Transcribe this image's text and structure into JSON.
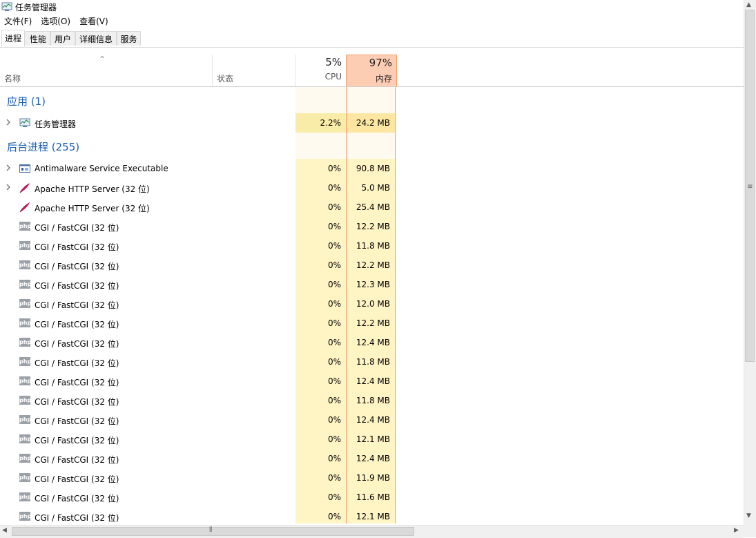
{
  "window": {
    "title": "任务管理器"
  },
  "menu": [
    "文件(F)",
    "选项(O)",
    "查看(V)"
  ],
  "tabs": [
    {
      "label": "进程",
      "active": true
    },
    {
      "label": "性能",
      "active": false
    },
    {
      "label": "用户",
      "active": false
    },
    {
      "label": "详细信息",
      "active": false
    },
    {
      "label": "服务",
      "active": false
    }
  ],
  "columns": {
    "name": "名称",
    "status": "状态",
    "cpu": {
      "percent": "5%",
      "label": "CPU"
    },
    "memory": {
      "percent": "97%",
      "label": "内存"
    }
  },
  "groups": {
    "apps": "应用 (1)",
    "background": "后台进程 (255)"
  },
  "apps": [
    {
      "name": "任务管理器",
      "cpu": "2.2%",
      "memory": "24.2 MB",
      "icon": "task-manager-icon",
      "expandable": true
    }
  ],
  "background": [
    {
      "name": "Antimalware Service Executable",
      "cpu": "0%",
      "memory": "90.8 MB",
      "icon": "service-icon",
      "expandable": true
    },
    {
      "name": "Apache HTTP Server (32 位)",
      "cpu": "0%",
      "memory": "5.0 MB",
      "icon": "apache-feather-icon",
      "expandable": true
    },
    {
      "name": "Apache HTTP Server (32 位)",
      "cpu": "0%",
      "memory": "25.4 MB",
      "icon": "apache-feather-icon",
      "expandable": false
    },
    {
      "name": "CGI / FastCGI (32 位)",
      "cpu": "0%",
      "memory": "12.2 MB",
      "icon": "php-icon",
      "expandable": false
    },
    {
      "name": "CGI / FastCGI (32 位)",
      "cpu": "0%",
      "memory": "11.8 MB",
      "icon": "php-icon",
      "expandable": false
    },
    {
      "name": "CGI / FastCGI (32 位)",
      "cpu": "0%",
      "memory": "12.2 MB",
      "icon": "php-icon",
      "expandable": false
    },
    {
      "name": "CGI / FastCGI (32 位)",
      "cpu": "0%",
      "memory": "12.3 MB",
      "icon": "php-icon",
      "expandable": false
    },
    {
      "name": "CGI / FastCGI (32 位)",
      "cpu": "0%",
      "memory": "12.0 MB",
      "icon": "php-icon",
      "expandable": false
    },
    {
      "name": "CGI / FastCGI (32 位)",
      "cpu": "0%",
      "memory": "12.2 MB",
      "icon": "php-icon",
      "expandable": false
    },
    {
      "name": "CGI / FastCGI (32 位)",
      "cpu": "0%",
      "memory": "12.4 MB",
      "icon": "php-icon",
      "expandable": false
    },
    {
      "name": "CGI / FastCGI (32 位)",
      "cpu": "0%",
      "memory": "11.8 MB",
      "icon": "php-icon",
      "expandable": false
    },
    {
      "name": "CGI / FastCGI (32 位)",
      "cpu": "0%",
      "memory": "12.4 MB",
      "icon": "php-icon",
      "expandable": false
    },
    {
      "name": "CGI / FastCGI (32 位)",
      "cpu": "0%",
      "memory": "11.8 MB",
      "icon": "php-icon",
      "expandable": false
    },
    {
      "name": "CGI / FastCGI (32 位)",
      "cpu": "0%",
      "memory": "12.4 MB",
      "icon": "php-icon",
      "expandable": false
    },
    {
      "name": "CGI / FastCGI (32 位)",
      "cpu": "0%",
      "memory": "12.1 MB",
      "icon": "php-icon",
      "expandable": false
    },
    {
      "name": "CGI / FastCGI (32 位)",
      "cpu": "0%",
      "memory": "12.4 MB",
      "icon": "php-icon",
      "expandable": false
    },
    {
      "name": "CGI / FastCGI (32 位)",
      "cpu": "0%",
      "memory": "11.9 MB",
      "icon": "php-icon",
      "expandable": false
    },
    {
      "name": "CGI / FastCGI (32 位)",
      "cpu": "0%",
      "memory": "11.6 MB",
      "icon": "php-icon",
      "expandable": false
    },
    {
      "name": "CGI / FastCGI (32 位)",
      "cpu": "0%",
      "memory": "12.1 MB",
      "icon": "php-icon",
      "expandable": false
    }
  ],
  "colors": {
    "group_heading": "#1a5fb4",
    "column_heat": "#fff4c4",
    "memory_header": "#fdcdb3",
    "memory_border": "#f0a070"
  }
}
